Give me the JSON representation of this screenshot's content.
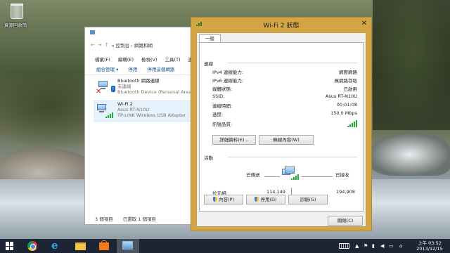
{
  "desktop": {
    "recycle_bin_label": "資源回收筒"
  },
  "explorer": {
    "address": {
      "nav_back": "←",
      "nav_fwd": "→",
      "nav_up": "↑",
      "breadcrumb": "« 控制台 › 網路和網"
    },
    "menu": [
      "檔案(F)",
      "編輯(E)",
      "檢視(V)",
      "工具(T)",
      "進階"
    ],
    "commands": [
      "組合管理 ▾",
      "停用",
      "停用這個網路"
    ],
    "adapters": [
      {
        "name": "Bluetooth 網路連線",
        "status": "未連線",
        "device": "Bluetooth Device (Personal Area"
      },
      {
        "name": "Wi-Fi 2",
        "status": "Asus RT-N10U",
        "device": "TP-LINK Wireless USB Adapter"
      }
    ],
    "statusbar": {
      "count": "3 個項目",
      "selected": "已選取 1 個項目"
    }
  },
  "dialog": {
    "title": "Wi-Fi 2 狀態",
    "close": "✕",
    "tab": "一般",
    "connection": {
      "label": "連線",
      "rows": [
        {
          "k": "IPv4 連線能力:",
          "v": "網際網路"
        },
        {
          "k": "IPv6 連線能力:",
          "v": "無網路存取"
        },
        {
          "k": "媒體狀態:",
          "v": "已啟用"
        },
        {
          "k": "SSID:",
          "v": "Asus RT-N10U"
        },
        {
          "k": "連線時間:",
          "v": "00:01:08"
        },
        {
          "k": "速度:",
          "v": "150.0 Mbps"
        }
      ],
      "signal_label": "訊號品質:",
      "signal_bars": 5
    },
    "buttons": {
      "details": "詳細資料(E)...",
      "wireless": "無線內容(W)"
    },
    "activity": {
      "label": "活動",
      "sent_label": "已傳送",
      "received_label": "已接收",
      "bytes_label": "位元組:",
      "bytes_sent": "114,149",
      "bytes_received": "194,908"
    },
    "action_buttons": {
      "properties": "內容(P)",
      "disable": "停用(D)",
      "diagnose": "診斷(G)"
    },
    "close_button": "關閉(C)"
  },
  "taskbar": {
    "clock_time": "上午 03:52",
    "clock_date": "2013/12/15"
  },
  "colors": {
    "dialog_frame": "#d3a545",
    "taskbar": "#1d2433",
    "signal": "#27a83a"
  }
}
